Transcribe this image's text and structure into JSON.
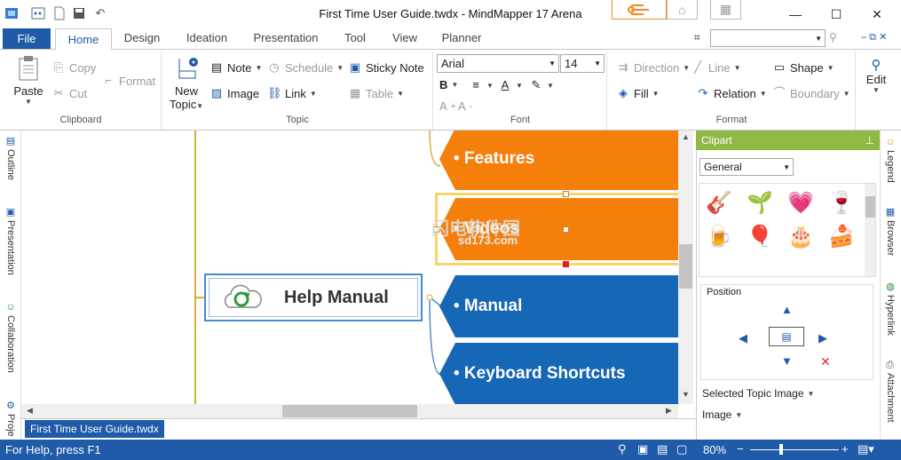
{
  "window": {
    "title": "First Time User Guide.twdx - MindMapper 17 Arena"
  },
  "tabs": {
    "file": "File",
    "items": [
      "Home",
      "Design",
      "Ideation",
      "Presentation",
      "Tool",
      "View",
      "Planner"
    ]
  },
  "clipboard": {
    "paste": "Paste",
    "copy": "Copy",
    "cut": "Cut",
    "format": "Format",
    "label": "Clipboard"
  },
  "topic": {
    "new1": "New",
    "new2": "Topic",
    "note": "Note",
    "schedule": "Schedule",
    "sticky": "Sticky Note",
    "image": "Image",
    "link": "Link",
    "table": "Table",
    "label": "Topic"
  },
  "font": {
    "family": "Arial",
    "size": "14",
    "label": "Font"
  },
  "format": {
    "direction": "Direction",
    "line": "Line",
    "shape": "Shape",
    "fill": "Fill",
    "relation": "Relation",
    "boundary": "Boundary",
    "label": "Format",
    "edit": "Edit"
  },
  "left_panel": {
    "outline": "Outline",
    "presentation": "Presentation",
    "collaboration": "Collaboration",
    "project": "Proje"
  },
  "right_panel": {
    "legend": "Legend",
    "browser": "Browser",
    "hyperlink": "Hyperlink",
    "attachment": "Attachment"
  },
  "map": {
    "central": "Help Manual",
    "topics": [
      {
        "text": "• Features",
        "color": "#f57f0b"
      },
      {
        "text": "• Videos",
        "color": "#f57f0b"
      },
      {
        "text": "• Manual",
        "color": "#1667b6"
      },
      {
        "text": "• Keyboard Shortcuts",
        "color": "#1667b6"
      }
    ]
  },
  "watermark": {
    "line1": "闪电软件园",
    "line2": "sd173.com"
  },
  "clipart": {
    "title": "Clipart",
    "category": "General",
    "position": "Position",
    "selected": "Selected Topic Image",
    "image": "Image"
  },
  "doc_tab": "First Time User Guide.twdx",
  "status": {
    "help": "For Help, press F1",
    "zoom": "80%"
  }
}
